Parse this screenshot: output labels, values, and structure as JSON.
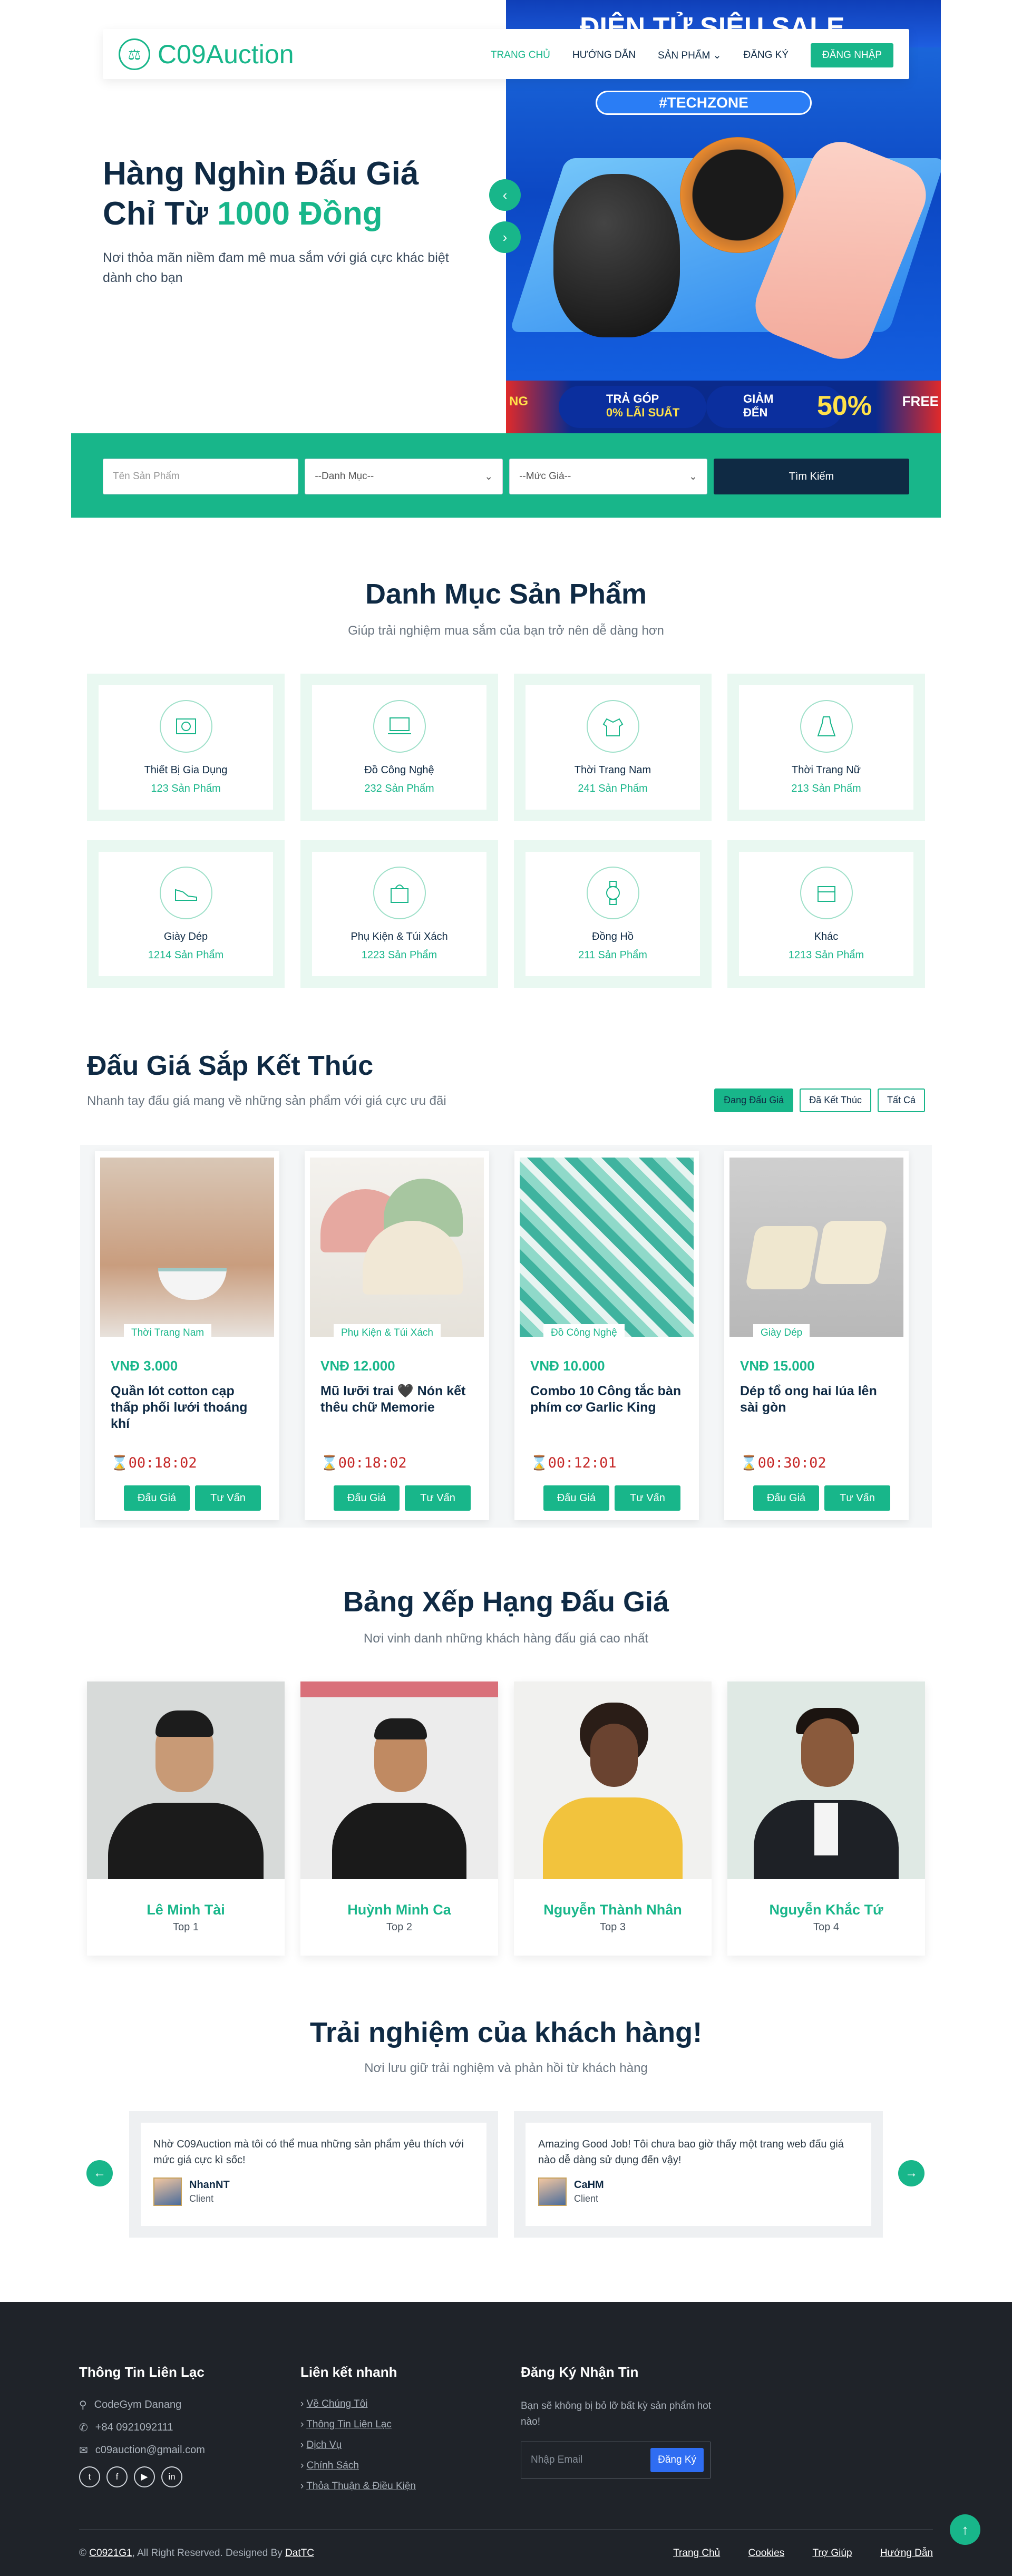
{
  "brand": {
    "logo_text": "C09Auction",
    "accent": "#18b68a",
    "dark": "#0f2a44"
  },
  "nav": {
    "items": [
      {
        "label": "TRANG CHỦ",
        "active": true
      },
      {
        "label": "HƯỚNG DẪN"
      },
      {
        "label": "SẢN PHẨM"
      },
      {
        "label": "ĐĂNG KÝ"
      }
    ],
    "login_label": "ĐĂNG NHẬP"
  },
  "hero": {
    "title_line1": "Hàng Nghìn Đấu Giá",
    "title_line2_prefix": "Chỉ Từ ",
    "title_line2_accent": "1000 Đồng",
    "subtitle": "Nơi thỏa mãn niềm đam mê mua sắm với giá cực khác biệt dành cho bạn",
    "banner": {
      "top_text": "ĐIỆN TỬ SIÊU SALE",
      "tag": "#TECHZONE",
      "promo1_line1": "TRẢ GÓP",
      "promo1_line2": "0% LÃI SUẤT",
      "promo2_line1": "GIẢM",
      "promo2_line2": "ĐẾN",
      "promo2_value": "50%",
      "left_edge": "NG",
      "right_edge": "FREE"
    }
  },
  "search": {
    "name_placeholder": "Tên Sản Phẩm",
    "category_selected": "--Danh Mục--",
    "price_selected": "--Mức Giá--",
    "button_label": "Tìm Kiếm"
  },
  "categories": {
    "title": "Danh Mục Sản Phẩm",
    "subtitle": "Giúp trải nghiệm mua sắm của bạn trở nên dễ dàng hơn",
    "items": [
      {
        "name": "Thiết Bị Gia Dụng",
        "count": "123 Sản Phẩm"
      },
      {
        "name": "Đồ Công Nghệ",
        "count": "232 Sản Phẩm"
      },
      {
        "name": "Thời Trang Nam",
        "count": "241 Sản Phẩm"
      },
      {
        "name": "Thời Trang Nữ",
        "count": "213 Sản Phẩm"
      },
      {
        "name": "Giày Dép",
        "count": "1214 Sản Phẩm"
      },
      {
        "name": "Phụ Kiện & Túi Xách",
        "count": "1223 Sản Phẩm"
      },
      {
        "name": "Đồng Hồ",
        "count": "211 Sản Phẩm"
      },
      {
        "name": "Khác",
        "count": "1213 Sản Phẩm"
      }
    ]
  },
  "auction": {
    "title": "Đấu Giá Sắp Kết Thúc",
    "subtitle": "Nhanh tay đấu giá mang về những sản phẩm với giá cực ưu đãi",
    "tabs": [
      "Đang Đấu Giá",
      "Đã Kết Thúc",
      "Tất Cả"
    ],
    "bid_label": "Đấu Giá",
    "consult_label": "Tư Vấn",
    "products": [
      {
        "category": "Thời Trang Nam",
        "price": "VNĐ 3.000",
        "name": "Quần lót cotton cạp thấp phối lưới thoáng khí",
        "time": "00:18:02"
      },
      {
        "category": "Phụ Kiện & Túi Xách",
        "price": "VNĐ 12.000",
        "name": "Mũ lưỡi trai 🖤 Nón kết thêu chữ Memorie",
        "time": "00:18:02"
      },
      {
        "category": "Đồ Công Nghệ",
        "price": "VNĐ 10.000",
        "name": "Combo 10 Công tắc bàn phím cơ Garlic King",
        "time": "00:12:01"
      },
      {
        "category": "Giày Dép",
        "price": "VNĐ 15.000",
        "name": "Dép tổ ong hai lúa lên sài gòn",
        "time": "00:30:02"
      }
    ]
  },
  "ranking": {
    "title": "Bảng Xếp Hạng Đấu Giá",
    "subtitle": "Nơi vinh danh những khách hàng đấu giá cao nhất",
    "users": [
      {
        "name": "Lê Minh Tài",
        "rank": "Top 1"
      },
      {
        "name": "Huỳnh Minh Ca",
        "rank": "Top 2"
      },
      {
        "name": "Nguyễn Thành Nhân",
        "rank": "Top 3"
      },
      {
        "name": "Nguyễn Khắc Tứ",
        "rank": "Top 4"
      }
    ]
  },
  "testimonials": {
    "title": "Trải nghiệm của khách hàng!",
    "subtitle": "Nơi lưu giữ trải nghiệm và phản hồi từ khách hàng",
    "items": [
      {
        "text": "Nhờ C09Auction mà tôi có thể mua những sản phẩm yêu thích với mức giá cực kì sốc!",
        "name": "NhanNT",
        "role": "Client"
      },
      {
        "text": "Amazing Good Job! Tôi chưa bao giờ thấy một trang web đấu giá nào dễ dàng sử dụng đến vậy!",
        "name": "CaHM",
        "role": "Client"
      }
    ]
  },
  "footer": {
    "contact_title": "Thông Tin Liên Lạc",
    "address": "CodeGym Danang",
    "phone": "+84 0921092111",
    "email": "c09auction@gmail.com",
    "links_title": "Liên kết nhanh",
    "links": [
      "Về Chúng Tôi",
      "Thông Tin Liên Lạc",
      "Dịch Vụ",
      "Chính Sách",
      "Thỏa Thuận & Điều Kiện"
    ],
    "newsletter_title": "Đăng Ký Nhận Tin",
    "newsletter_text": "Bạn sẽ không bị bỏ lỡ bất kỳ sản phẩm hot nào!",
    "newsletter_placeholder": "Nhập Email",
    "newsletter_button": "Đăng Ký",
    "copyright_prefix": "© ",
    "copyright_brand": "C0921G1",
    "copyright_mid": ", All Right Reserved. Designed By ",
    "copyright_designer": "DatTC",
    "bottom_links": [
      "Trang Chủ",
      "Cookies",
      "Trợ Giúp",
      "Hướng Dẫn"
    ]
  }
}
